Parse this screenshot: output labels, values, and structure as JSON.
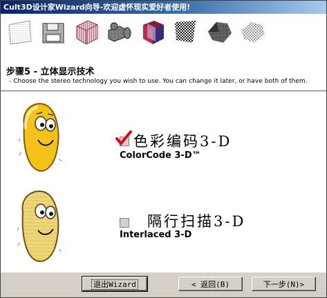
{
  "window": {
    "title": "Cult3D设计家Wizard向导-欢迎虚怀现实爱好者使用!"
  },
  "header": {
    "step_title": "步骤5 - 立体显示技术",
    "step_description": "- Choose the stereo technology you wish to use. You can change it later, or have both of them.",
    "icon_strip": [
      "paper-texture-icon",
      "floppy-disk-icon",
      "wire-cube-icon",
      "camera-icon",
      "stereo-cube-icon",
      "checker-plane-icon",
      "shaded-gem-icon",
      "grid-sphere-icon"
    ]
  },
  "options": [
    {
      "id": "colorcode",
      "title_zh": "色彩编码3-D",
      "title_en": "ColorCode 3-D™",
      "checked": true
    },
    {
      "id": "interlaced",
      "title_zh": "隔行扫描3-D",
      "title_en": "Interlaced 3-D",
      "checked": false
    }
  ],
  "footer": {
    "exit_label": "退出Wizard",
    "back_label": "< 返回(B)",
    "next_label": "下一步(N)>"
  },
  "colors": {
    "title_bar_start": "#0a246a",
    "title_bar_end": "#a6caf0",
    "checkmark": "#e0001b",
    "face_yellow": "#f5c21a",
    "window_face": "#d4d0c8"
  }
}
